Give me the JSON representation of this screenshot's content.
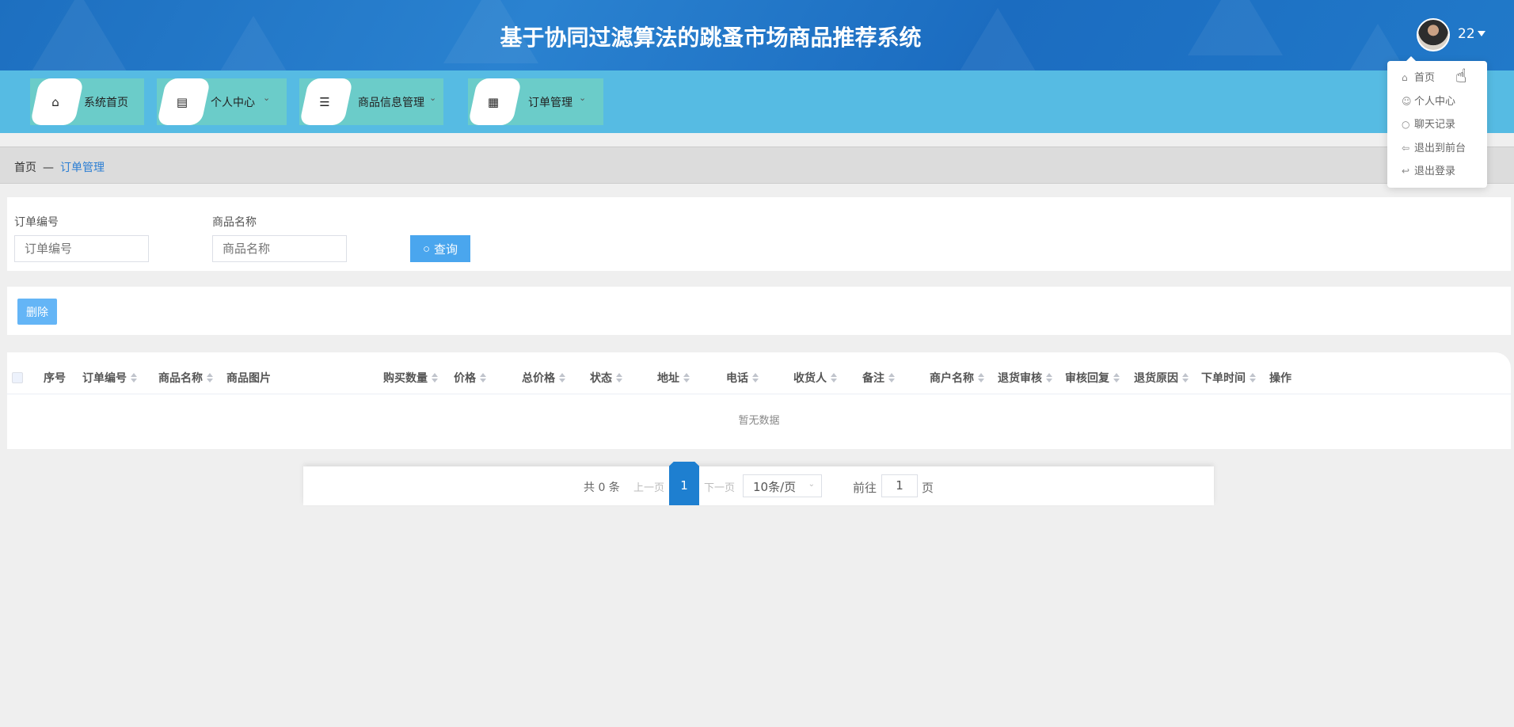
{
  "header": {
    "title": "基于协同过滤算法的跳蚤市场商品推荐系统",
    "username": "22"
  },
  "user_menu": [
    {
      "icon": "home-icon",
      "glyph": "⌂",
      "label": "首页"
    },
    {
      "icon": "user-icon",
      "glyph": "☺",
      "label": "个人中心"
    },
    {
      "icon": "search-icon",
      "glyph": "○",
      "label": "聊天记录"
    },
    {
      "icon": "back-arrow-icon",
      "glyph": "⇦",
      "label": "退出到前台"
    },
    {
      "icon": "logout-icon",
      "glyph": "↩",
      "label": "退出登录"
    }
  ],
  "nav": [
    {
      "icon": "home-icon",
      "glyph": "⌂",
      "label": "系统首页",
      "chevron": false
    },
    {
      "icon": "card-icon",
      "glyph": "▤",
      "label": "个人中心",
      "chevron": true
    },
    {
      "icon": "sliders-icon",
      "glyph": "☰",
      "label": "商品信息管理",
      "chevron": true
    },
    {
      "icon": "grid-icon",
      "glyph": "▦",
      "label": "订单管理",
      "chevron": true
    }
  ],
  "breadcrumb": {
    "home": "首页",
    "separator": "—",
    "current": "订单管理"
  },
  "search": {
    "order_no_label": "订单编号",
    "order_no_placeholder": "订单编号",
    "order_no_value": "",
    "product_name_label": "商品名称",
    "product_name_placeholder": "商品名称",
    "product_name_value": "",
    "search_button": "查询"
  },
  "actions": {
    "delete_button": "删除"
  },
  "table": {
    "columns": [
      "序号",
      "订单编号",
      "商品名称",
      "商品图片",
      "购买数量",
      "价格",
      "总价格",
      "状态",
      "地址",
      "电话",
      "收货人",
      "备注",
      "商户名称",
      "退货审核",
      "审核回复",
      "退货原因",
      "下单时间",
      "操作"
    ],
    "sortable": [
      false,
      true,
      true,
      false,
      true,
      true,
      true,
      true,
      true,
      true,
      true,
      true,
      true,
      true,
      true,
      true,
      true,
      false
    ],
    "rows": [],
    "empty_text": "暂无数据"
  },
  "pagination": {
    "total_text": "共 0 条",
    "prev": "上一页",
    "current_page": "1",
    "next": "下一页",
    "page_size": "10条/页",
    "goto_label": "前往",
    "goto_value": "1",
    "goto_suffix": "页"
  }
}
